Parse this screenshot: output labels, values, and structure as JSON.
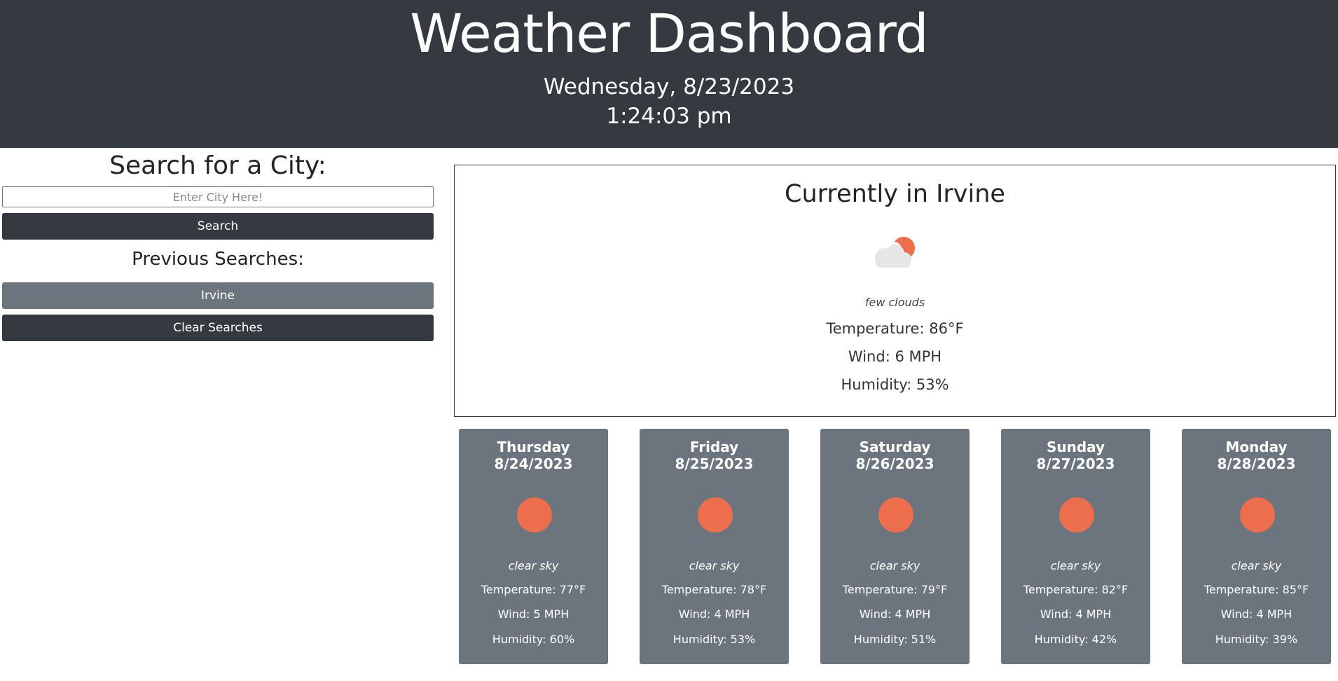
{
  "header": {
    "title": "Weather Dashboard",
    "date": "Wednesday, 8/23/2023",
    "time": "1:24:03 pm"
  },
  "search": {
    "title": "Search for a City:",
    "placeholder": "Enter City Here!",
    "value": "",
    "button_label": "Search",
    "previous_title": "Previous Searches:",
    "history": [
      {
        "label": "Irvine"
      }
    ],
    "clear_label": "Clear Searches"
  },
  "current": {
    "heading": "Currently in Irvine",
    "icon": "few-clouds-icon",
    "description": "few clouds",
    "temperature": "Temperature: 86°F",
    "wind": "Wind: 6 MPH",
    "humidity": "Humidity: 53%"
  },
  "forecast": [
    {
      "day": "Thursday",
      "date": "8/24/2023",
      "icon": "clear-sky-icon",
      "description": "clear sky",
      "temperature": "Temperature: 77°F",
      "wind": "Wind: 5 MPH",
      "humidity": "Humidity: 60%"
    },
    {
      "day": "Friday",
      "date": "8/25/2023",
      "icon": "clear-sky-icon",
      "description": "clear sky",
      "temperature": "Temperature: 78°F",
      "wind": "Wind: 4 MPH",
      "humidity": "Humidity: 53%"
    },
    {
      "day": "Saturday",
      "date": "8/26/2023",
      "icon": "clear-sky-icon",
      "description": "clear sky",
      "temperature": "Temperature: 79°F",
      "wind": "Wind: 4 MPH",
      "humidity": "Humidity: 51%"
    },
    {
      "day": "Sunday",
      "date": "8/27/2023",
      "icon": "clear-sky-icon",
      "description": "clear sky",
      "temperature": "Temperature: 82°F",
      "wind": "Wind: 4 MPH",
      "humidity": "Humidity: 42%"
    },
    {
      "day": "Monday",
      "date": "8/28/2023",
      "icon": "clear-sky-icon",
      "description": "clear sky",
      "temperature": "Temperature: 85°F",
      "wind": "Wind: 4 MPH",
      "humidity": "Humidity: 39%"
    }
  ],
  "colors": {
    "header_bg": "#343a40",
    "card_bg": "#6c757d",
    "sun": "#ec6e4c",
    "cloud": "#e6e6e6"
  }
}
